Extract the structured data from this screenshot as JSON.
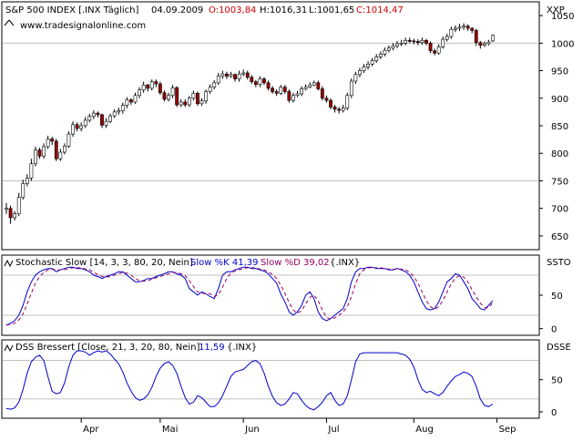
{
  "header": {
    "symbol": "S&P 500 INDEX [.INX Täglich]",
    "date": "04.09.2009",
    "open_label": "O:1003,84",
    "high_label": "H:1016,31",
    "low_label": "L:1001,65",
    "close_label": "C:1014,47",
    "source": "www.tradesignalonline.com",
    "price_axis_label": "XXP"
  },
  "colors": {
    "background": "#ffffff",
    "plot_border": "#000000",
    "gridline": "#c0c0c0",
    "candle_up": "#ffffff",
    "candle_down": "#990000",
    "candle_outline": "#000000",
    "stoch_k": "#0000cc",
    "stoch_d": "#990066",
    "dss": "#0000cc",
    "open_text": "#cc0000",
    "close_text": "#cc0000"
  },
  "chart_data": [
    {
      "type": "candlestick",
      "title": "S&P 500 INDEX [.INX Täglich]",
      "y_ticks": [
        650,
        700,
        750,
        800,
        850,
        900,
        950,
        1000,
        1050
      ],
      "ylim": [
        625,
        1075
      ],
      "hlines": [
        750,
        1000
      ],
      "x_ticks": [
        "Apr",
        "Mai",
        "Jun",
        "Jul",
        "Aug",
        "Sep"
      ],
      "x_tick_index": [
        18,
        37,
        57,
        77,
        98,
        118
      ],
      "close": [
        700,
        683,
        690,
        720,
        745,
        755,
        781,
        806,
        795,
        812,
        826,
        822,
        790,
        802,
        813,
        835,
        852,
        845,
        850,
        860,
        867,
        873,
        870,
        851,
        858,
        868,
        875,
        877,
        887,
        897,
        893,
        905,
        915,
        924,
        918,
        930,
        926,
        910,
        898,
        905,
        919,
        888,
        893,
        888,
        900,
        909,
        890,
        895,
        912,
        920,
        928,
        940,
        944,
        940,
        943,
        935,
        944,
        946,
        938,
        930,
        925,
        935,
        928,
        918,
        912,
        909,
        920,
        912,
        896,
        905,
        908,
        917,
        920,
        924,
        928,
        917,
        900,
        896,
        884,
        880,
        878,
        882,
        905,
        931,
        943,
        950,
        957,
        962,
        968,
        975,
        980,
        987,
        991,
        995,
        999,
        1000,
        1005,
        1004,
        1003,
        1001,
        1005,
        1000,
        986,
        982,
        993,
        1007,
        1012,
        1025,
        1027,
        1029,
        1031,
        1027,
        1023,
        1001,
        996,
        999,
        1002,
        1014
      ],
      "open": [
        698,
        700,
        683,
        690,
        720,
        745,
        755,
        781,
        806,
        795,
        812,
        826,
        822,
        790,
        802,
        813,
        835,
        852,
        845,
        850,
        860,
        867,
        873,
        870,
        851,
        858,
        868,
        875,
        877,
        887,
        897,
        893,
        905,
        915,
        924,
        918,
        930,
        926,
        910,
        898,
        905,
        919,
        888,
        893,
        888,
        900,
        909,
        890,
        895,
        912,
        920,
        928,
        940,
        944,
        940,
        943,
        935,
        944,
        946,
        938,
        930,
        925,
        935,
        928,
        918,
        912,
        909,
        920,
        912,
        896,
        905,
        908,
        917,
        920,
        924,
        928,
        917,
        900,
        896,
        884,
        880,
        878,
        882,
        905,
        931,
        943,
        950,
        957,
        962,
        968,
        975,
        980,
        987,
        991,
        995,
        999,
        1000,
        1005,
        1004,
        1003,
        1001,
        1005,
        1000,
        986,
        982,
        993,
        1007,
        1012,
        1025,
        1027,
        1029,
        1031,
        1027,
        1023,
        1001,
        996,
        999,
        1004
      ],
      "high": [
        710,
        705,
        695,
        728,
        752,
        762,
        790,
        812,
        810,
        818,
        832,
        830,
        826,
        808,
        818,
        840,
        858,
        856,
        856,
        866,
        872,
        878,
        876,
        872,
        864,
        872,
        880,
        883,
        892,
        902,
        900,
        910,
        920,
        930,
        926,
        934,
        934,
        930,
        914,
        910,
        924,
        922,
        898,
        898,
        904,
        914,
        912,
        900,
        916,
        925,
        933,
        946,
        950,
        948,
        948,
        945,
        950,
        952,
        950,
        942,
        933,
        940,
        938,
        932,
        922,
        916,
        924,
        924,
        916,
        910,
        913,
        922,
        925,
        929,
        932,
        932,
        922,
        905,
        900,
        888,
        884,
        888,
        910,
        936,
        948,
        955,
        962,
        967,
        973,
        980,
        985,
        992,
        996,
        1000,
        1004,
        1006,
        1010,
        1010,
        1008,
        1007,
        1010,
        1008,
        1003,
        990,
        998,
        1012,
        1017,
        1030,
        1032,
        1035,
        1036,
        1034,
        1029,
        1026,
        1004,
        1003,
        1006,
        1016
      ],
      "low": [
        690,
        672,
        678,
        686,
        716,
        740,
        750,
        776,
        790,
        790,
        808,
        815,
        786,
        786,
        798,
        810,
        830,
        840,
        840,
        846,
        856,
        862,
        865,
        846,
        846,
        855,
        864,
        870,
        872,
        882,
        888,
        890,
        900,
        910,
        912,
        914,
        920,
        906,
        894,
        894,
        900,
        884,
        884,
        884,
        884,
        896,
        886,
        886,
        890,
        908,
        916,
        924,
        935,
        935,
        937,
        930,
        930,
        940,
        934,
        926,
        920,
        920,
        924,
        914,
        908,
        904,
        906,
        908,
        892,
        892,
        902,
        904,
        914,
        918,
        922,
        914,
        896,
        892,
        880,
        874,
        872,
        874,
        878,
        900,
        926,
        938,
        946,
        952,
        958,
        964,
        971,
        976,
        983,
        987,
        991,
        995,
        996,
        1000,
        998,
        996,
        997,
        996,
        982,
        978,
        979,
        990,
        1003,
        1008,
        1020,
        1022,
        1024,
        1022,
        1018,
        995,
        990,
        993,
        996,
        1002
      ]
    },
    {
      "type": "line",
      "title": "Stochastic Slow [14, 3, 3, 80, 20, Nein]",
      "legend": [
        "Slow %K 41,39",
        "Slow %D 39,02",
        "{.INX}"
      ],
      "axis_label": "SSTO",
      "y_ticks": [
        0,
        50
      ],
      "ylim": [
        -10,
        110
      ],
      "hlines": [
        20,
        80
      ],
      "series": [
        {
          "name": "Slow %K",
          "style": "solid",
          "values": [
            5,
            8,
            12,
            20,
            35,
            55,
            70,
            80,
            85,
            88,
            90,
            90,
            85,
            88,
            90,
            92,
            92,
            90,
            90,
            88,
            85,
            80,
            78,
            75,
            78,
            80,
            82,
            85,
            85,
            80,
            75,
            70,
            70,
            72,
            75,
            75,
            78,
            80,
            82,
            85,
            85,
            82,
            80,
            75,
            60,
            55,
            50,
            55,
            52,
            48,
            45,
            60,
            80,
            85,
            85,
            88,
            90,
            92,
            92,
            90,
            90,
            88,
            86,
            82,
            75,
            68,
            52,
            40,
            25,
            20,
            25,
            35,
            50,
            55,
            45,
            25,
            15,
            12,
            15,
            20,
            25,
            30,
            45,
            70,
            85,
            90,
            90,
            92,
            92,
            90,
            90,
            90,
            88,
            88,
            90,
            88,
            85,
            80,
            70,
            55,
            40,
            30,
            28,
            30,
            40,
            55,
            70,
            75,
            82,
            80,
            70,
            60,
            45,
            38,
            30,
            28,
            35,
            42
          ]
        },
        {
          "name": "Slow %D",
          "style": "dashed",
          "values": [
            6,
            6,
            8,
            13,
            22,
            37,
            53,
            68,
            78,
            84,
            88,
            89,
            88,
            88,
            88,
            90,
            91,
            91,
            91,
            89,
            88,
            84,
            81,
            78,
            77,
            78,
            80,
            82,
            84,
            83,
            80,
            75,
            72,
            71,
            72,
            74,
            76,
            78,
            80,
            82,
            84,
            84,
            82,
            79,
            72,
            63,
            55,
            53,
            52,
            52,
            48,
            51,
            62,
            75,
            83,
            86,
            88,
            90,
            91,
            91,
            91,
            89,
            88,
            85,
            81,
            75,
            65,
            53,
            39,
            28,
            23,
            27,
            37,
            47,
            50,
            42,
            28,
            17,
            14,
            16,
            20,
            25,
            33,
            48,
            67,
            82,
            88,
            91,
            91,
            91,
            91,
            90,
            89,
            89,
            89,
            89,
            88,
            84,
            78,
            68,
            55,
            42,
            33,
            29,
            33,
            42,
            55,
            67,
            76,
            79,
            77,
            70,
            58,
            48,
            38,
            32,
            31,
            39
          ]
        }
      ]
    },
    {
      "type": "line",
      "title": "DSS Bressert [Close, 21, 3, 20, 80, Nein]",
      "legend": [
        "11,59",
        "{.INX}"
      ],
      "axis_label": "DSSE",
      "y_ticks": [
        0,
        50
      ],
      "ylim": [
        -10,
        112
      ],
      "hlines": [
        20,
        80
      ],
      "series": [
        {
          "name": "DSS",
          "style": "solid",
          "values": [
            5,
            4,
            6,
            15,
            35,
            60,
            78,
            85,
            88,
            80,
            55,
            32,
            28,
            30,
            45,
            70,
            88,
            95,
            95,
            93,
            88,
            92,
            95,
            93,
            95,
            90,
            82,
            75,
            62,
            45,
            32,
            22,
            18,
            20,
            26,
            38,
            55,
            68,
            75,
            78,
            72,
            60,
            40,
            22,
            12,
            15,
            25,
            22,
            15,
            8,
            8,
            14,
            25,
            40,
            55,
            62,
            64,
            66,
            72,
            78,
            80,
            75,
            60,
            40,
            24,
            14,
            10,
            12,
            20,
            30,
            28,
            18,
            10,
            5,
            3,
            8,
            15,
            25,
            30,
            18,
            10,
            12,
            25,
            50,
            78,
            90,
            92,
            92,
            92,
            92,
            92,
            92,
            92,
            92,
            92,
            90,
            88,
            82,
            70,
            50,
            35,
            30,
            32,
            28,
            25,
            30,
            40,
            48,
            55,
            58,
            62,
            60,
            55,
            40,
            20,
            10,
            8,
            12
          ]
        }
      ]
    }
  ]
}
